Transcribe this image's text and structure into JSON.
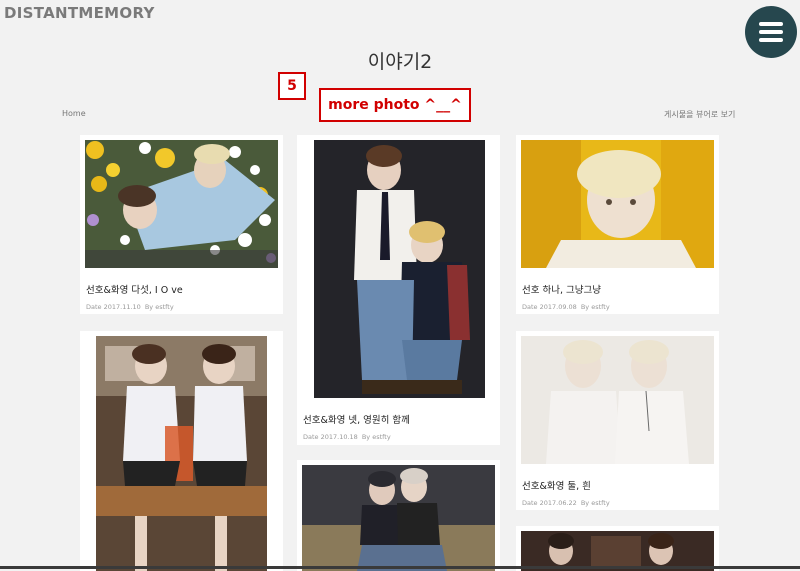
{
  "header": {
    "logo": "DISTANTMEMORY",
    "menu_icon": "hamburger-icon"
  },
  "page": {
    "title": "이야기2",
    "breadcrumb": "Home",
    "list_toggle": "게시물을 뷰어로 보기"
  },
  "annotation": {
    "number": "5",
    "label": "more photo ^__^"
  },
  "posts": [
    {
      "title": "선호&화영 다섯, I O ve",
      "date": "Date 2017.11.10",
      "author": "By estfty"
    },
    {
      "title": "선호&화영 넷, 영원히 함께",
      "date": "Date 2017.10.18",
      "author": "By estfty"
    },
    {
      "title": "선호 하나, 그냥그냥",
      "date": "Date 2017.09.08",
      "author": "By estfty"
    },
    {
      "title": "선호&화영 둘, 흰",
      "date": "Date 2017.06.22",
      "author": "By estfty"
    }
  ],
  "colors": {
    "accent_red": "#d10000",
    "menu_bg": "#26474e",
    "background": "#f2f2f2"
  }
}
